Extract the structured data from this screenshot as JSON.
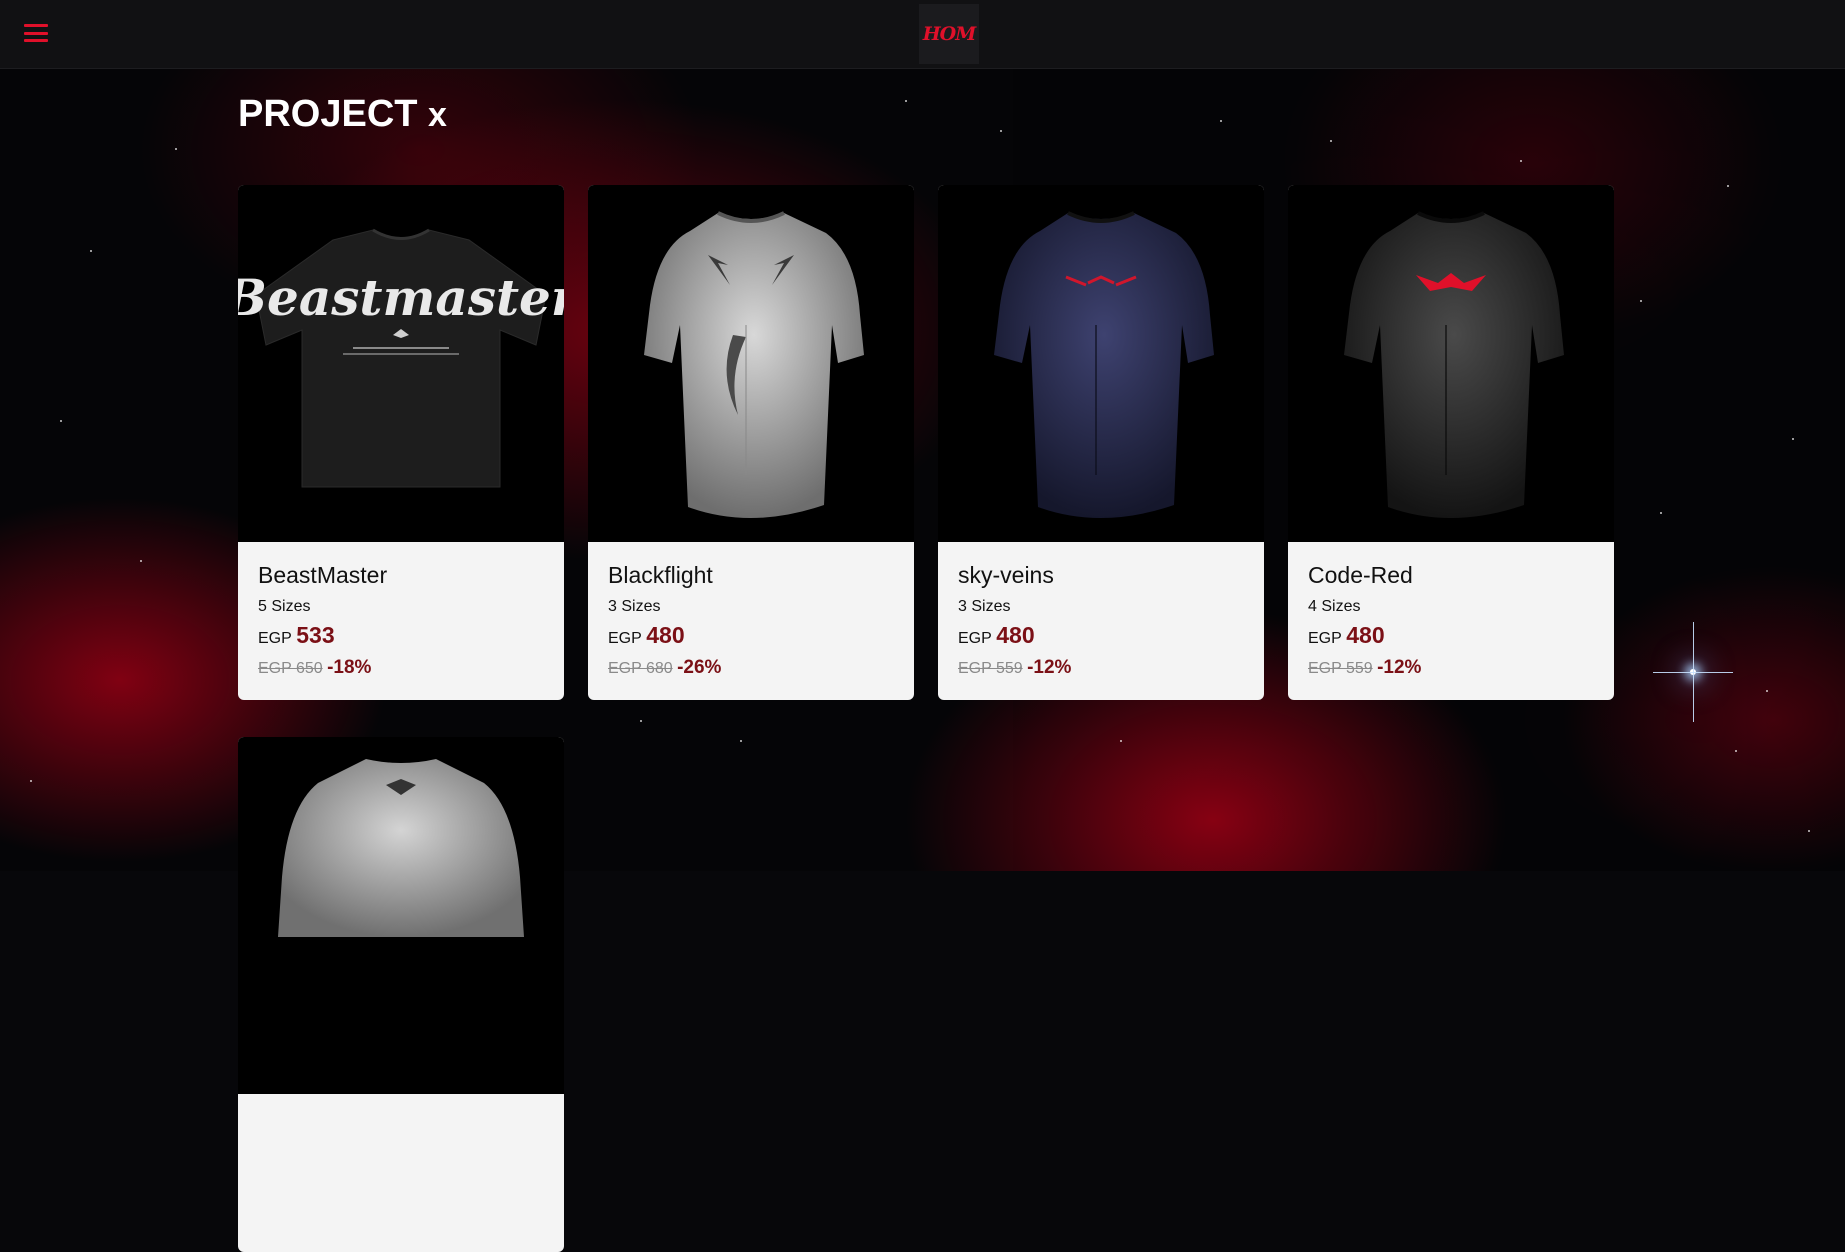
{
  "header": {
    "menu_icon": "hamburger-menu-icon",
    "logo_text": "HOM",
    "accent_color": "#e0102a"
  },
  "page": {
    "title": "PROJECT",
    "title_suffix": "x"
  },
  "products": [
    {
      "name": "BeastMaster",
      "sizes": "5 Sizes",
      "currency": "EGP",
      "price": "533",
      "old_price": "EGP 650",
      "discount": "-18%",
      "image_icon": "oversized-tshirt-print-icon",
      "print_text": "Beastmaster"
    },
    {
      "name": "Blackflight",
      "sizes": "3 Sizes",
      "currency": "EGP",
      "price": "480",
      "old_price": "EGP 680",
      "discount": "-26%",
      "image_icon": "compression-shirt-icon"
    },
    {
      "name": "sky-veins",
      "sizes": "3 Sizes",
      "currency": "EGP",
      "price": "480",
      "old_price": "EGP 559",
      "discount": "-12%",
      "image_icon": "compression-shirt-icon"
    },
    {
      "name": "Code-Red",
      "sizes": "4 Sizes",
      "currency": "EGP",
      "price": "480",
      "old_price": "EGP 559",
      "discount": "-12%",
      "image_icon": "compression-shirt-icon"
    },
    {
      "image_icon": "compression-shirt-back-icon"
    }
  ],
  "colors": {
    "price_color": "#7b1016",
    "shirt_blackflight": "#b9b9b9",
    "shirt_skyveins": "#2a2c4a",
    "shirt_codered": "#2c2c2c",
    "print_codered": "#e0102a"
  }
}
